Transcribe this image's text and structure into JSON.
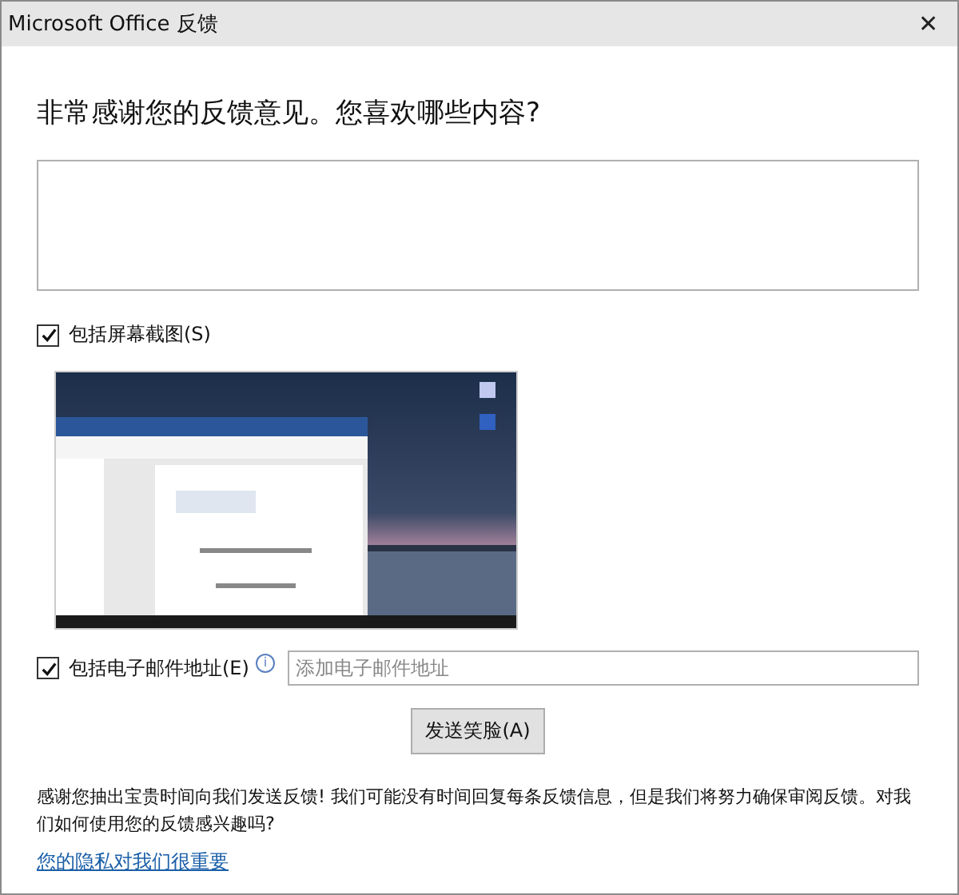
{
  "window": {
    "title": "Microsoft Office 反馈",
    "close": "✕"
  },
  "heading": "非常感谢您的反馈意见。您喜欢哪些内容?",
  "screenshot_option": {
    "label": "包括屏幕截图(S)",
    "checked": true
  },
  "email_option": {
    "label": "包括电子邮件地址(E)",
    "checked": true,
    "info": "i"
  },
  "email_field": {
    "placeholder": "添加电子邮件地址"
  },
  "send_button": "发送笑脸(A)",
  "notice": "感谢您抽出宝贵时间向我们发送反馈! 我们可能没有时间回复每条反馈信息，但是我们将努力确保审阅反馈。对我们如何使用您的反馈感兴趣吗?",
  "privacy_link": "您的隐私对我们很重要"
}
